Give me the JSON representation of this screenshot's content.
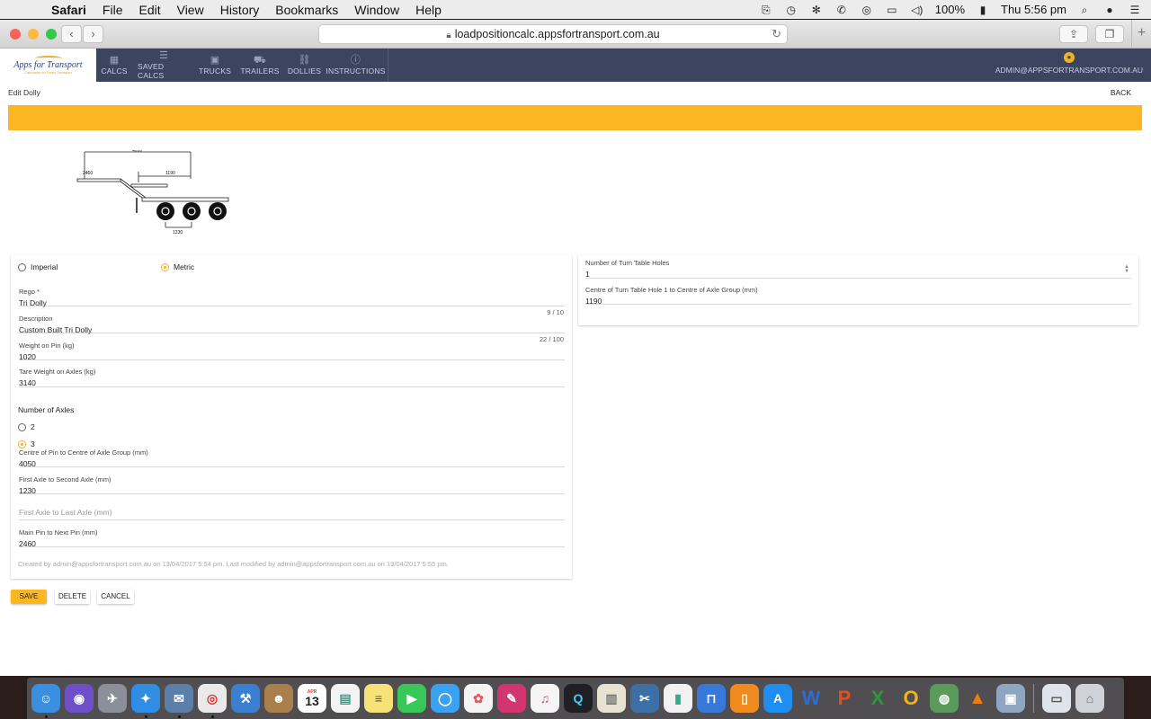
{
  "menubar": {
    "app_name": "Safari",
    "items": [
      "File",
      "Edit",
      "View",
      "History",
      "Bookmarks",
      "Window",
      "Help"
    ],
    "battery": "100%",
    "clock": "Thu 5:56 pm"
  },
  "browser": {
    "url": "loadpositioncalc.appsfortransport.com.au"
  },
  "app": {
    "logo_name": "Apps for Transport",
    "logo_tagline": "Calculator for Road Transport",
    "nav": [
      {
        "label": "CALCS",
        "icon": "calculator-icon"
      },
      {
        "label": "SAVED CALCS",
        "icon": "list-icon"
      },
      {
        "label": "TRUCKS",
        "icon": "truck-icon"
      },
      {
        "label": "TRAILERS",
        "icon": "trailer-icon"
      },
      {
        "label": "DOLLIES",
        "icon": "link-icon"
      },
      {
        "label": "INSTRUCTIONS",
        "icon": "info-icon"
      }
    ],
    "user_email": "ADMIN@APPSFORTRANSPORT.COM.AU"
  },
  "page": {
    "title": "Edit Dolly",
    "back_label": "BACK"
  },
  "diagram": {
    "dim_top": "4050",
    "dim_mid": "1190",
    "dim_left": "2460",
    "dim_bottom": "1230"
  },
  "form": {
    "units": [
      {
        "label": "Imperial",
        "selected": false
      },
      {
        "label": "Metric",
        "selected": true
      }
    ],
    "rego": {
      "label": "Rego *",
      "value": "Tri Dolly",
      "counter": "9 / 10"
    },
    "description": {
      "label": "Description",
      "value": "Custom Built Tri Dolly",
      "counter": "22 / 100"
    },
    "weight_on_pin": {
      "label": "Weight on Pin (kg)",
      "value": "1020"
    },
    "tare_weight": {
      "label": "Tare Weight on Axles (kg)",
      "value": "3140"
    },
    "axles_title": "Number of Axles",
    "axle_options": [
      {
        "label": "2",
        "selected": false
      },
      {
        "label": "3",
        "selected": true
      }
    ],
    "centre_pin_axle": {
      "label": "Centre of Pin to Centre of Axle Group (mm)",
      "value": "4050"
    },
    "first_second_axle": {
      "label": "First Axle to Second Axle (mm)",
      "value": "1230"
    },
    "first_last_axle": {
      "placeholder": "First Axle to Last Axle (mm)"
    },
    "main_pin_next": {
      "label": "Main Pin to Next Pin (mm)",
      "value": "2460"
    },
    "meta": "Created by admin@appsfortransport.com.au on 13/04/2017 5:54 pm. Last modified by admin@appsfortransport.com.au on 13/04/2017 5:55 pm.",
    "turntable_holes": {
      "label": "Number of Turn Table Holes",
      "value": "1"
    },
    "turntable_centre": {
      "label": "Centre of Turn Table Hole 1 to Centre of Axle Group (mm)",
      "value": "1190"
    }
  },
  "buttons": {
    "save": "SAVE",
    "delete": "DELETE",
    "cancel": "CANCEL"
  },
  "colors": {
    "accent": "#fbb622",
    "header": "#3c4560"
  },
  "dock": {
    "calendar_month": "APR",
    "calendar_day": "13"
  }
}
